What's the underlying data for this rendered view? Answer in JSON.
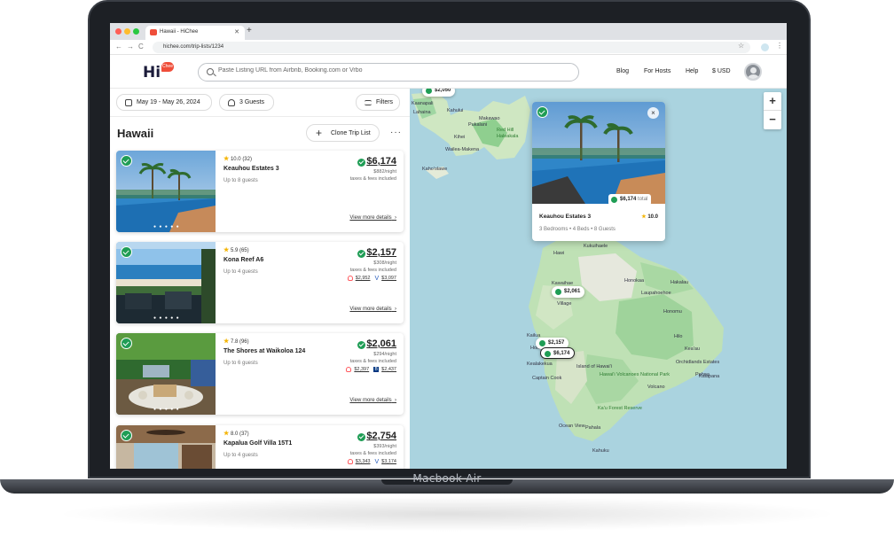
{
  "device": {
    "label": "Macbook Air"
  },
  "browser": {
    "tab_title": "Hawaii - HiChee",
    "url": "hichee.com/trip-lists/1234"
  },
  "header": {
    "logo": "Hi",
    "logo_badge": "Chee",
    "search_placeholder": "Paste Listing URL from Airbnb, Booking.com or Vrbo",
    "nav": [
      "Blog",
      "For Hosts",
      "Help",
      "$ USD"
    ]
  },
  "filters": {
    "dates": "May 19 - May 26, 2024",
    "guests": "3 Guests",
    "filters_label": "Filters"
  },
  "list": {
    "title": "Hawaii",
    "clone_label": "Clone Trip List",
    "more": "···"
  },
  "cards": [
    {
      "rating": "10.0",
      "reviews": "(32)",
      "name": "Keauhou Estates 3",
      "guests": "Up to 8 guests",
      "price": "$6,174",
      "night": "$882/night",
      "fees": "taxes & fees included",
      "alt": [],
      "view": "View more details"
    },
    {
      "rating": "5.9",
      "reviews": "(65)",
      "name": "Kona Reef A6",
      "guests": "Up to 4 guests",
      "price": "$2,157",
      "night": "$308/night",
      "fees": "taxes & fees included",
      "alt": [
        "$2,952",
        "$3,097"
      ],
      "view": "View more details"
    },
    {
      "rating": "7.8",
      "reviews": "(96)",
      "name": "The Shores at Waikoloa 124",
      "guests": "Up to 6 guests",
      "price": "$2,061",
      "night": "$294/night",
      "fees": "taxes & fees included",
      "alt": [
        "$2,397",
        "$2,437"
      ],
      "view": "View more details"
    },
    {
      "rating": "8.0",
      "reviews": "(37)",
      "name": "Kapalua Golf Villa 15T1",
      "guests": "Up to 4 guests",
      "price": "$2,754",
      "night": "$393/night",
      "fees": "taxes & fees included",
      "alt": [
        "$3,343",
        "$3,174"
      ],
      "view": "View more details"
    }
  ],
  "map": {
    "zoom_in": "+",
    "zoom_out": "−",
    "places": [
      "Kaanapali",
      "Lahaina",
      "Kahului",
      "Makawao",
      "Kihei",
      "Pukalani",
      "Red Hill",
      "Haleakala",
      "Wailea-Makena",
      "Kaho'olawe",
      "Kukuihaele",
      "Hawi",
      "Kawaihae",
      "Honokaa",
      "Laupahoehoe",
      "Village",
      "Honomu",
      "Hilo",
      "Kailua",
      "Kealakekua",
      "Kea'au",
      "Orchidlands Estates",
      "Pahoa",
      "Island of Hawai'i",
      "Hawai'i Volcanoes National Park",
      "Captain Cook",
      "Volcano",
      "Kalapana",
      "Ka'u Forest Reserve",
      "Pahala",
      "Ocean View",
      "Kahuku",
      "Holualoa",
      "Hakalau"
    ],
    "markers": [
      "$2,050",
      "$2,061",
      "$2,157",
      "$6,174"
    ],
    "popup": {
      "total": "$6,174",
      "total_suffix": "total",
      "name": "Keauhou Estates 3",
      "rating": "10.0",
      "details": "3 Bedrooms • 4 Beds • 8 Guests",
      "close": "×"
    }
  }
}
